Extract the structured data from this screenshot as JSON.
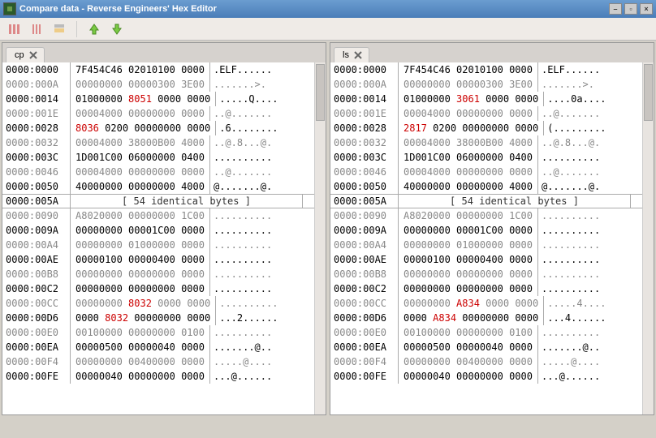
{
  "window_title": "Compare data - Reverse Engineers' Hex Editor",
  "toolbar": {
    "icons": [
      "bars-wide-icon",
      "bars-mid-icon",
      "bars-narrow-icon",
      "arrow-up-icon",
      "arrow-down-icon"
    ]
  },
  "panes": [
    {
      "tab_label": "cp",
      "collapsed": {
        "addr": "0000:005A",
        "msg": "[ 54 identical bytes ]"
      },
      "rows_top": [
        {
          "a": "0000:0000",
          "h": [
            [
              "7F454C46",
              0
            ],
            [
              "02010100",
              0
            ],
            [
              "0000",
              0
            ]
          ],
          "t": ".ELF......"
        },
        {
          "a": "0000:000A",
          "m": 1,
          "h": [
            [
              "00000000",
              0
            ],
            [
              "00000300",
              0
            ],
            [
              "3E00",
              0
            ]
          ],
          "t": ".......>."
        },
        {
          "a": "0000:0014",
          "h": [
            [
              "01000000",
              0
            ],
            [
              "8051",
              1
            ],
            [
              "0000",
              0
            ],
            [
              "0000",
              0
            ]
          ],
          "t": ".....Q...."
        },
        {
          "a": "0000:001E",
          "m": 1,
          "h": [
            [
              "00004000",
              0
            ],
            [
              "00000000",
              0
            ],
            [
              "0000",
              0
            ]
          ],
          "t": "..@......."
        },
        {
          "a": "0000:0028",
          "h": [
            [
              "8036",
              1
            ],
            [
              "0200",
              0
            ],
            [
              "00000000",
              0
            ],
            [
              "0000",
              0
            ]
          ],
          "t": ".6........"
        },
        {
          "a": "0000:0032",
          "m": 1,
          "h": [
            [
              "00004000",
              0
            ],
            [
              "38000B00",
              0
            ],
            [
              "4000",
              0
            ]
          ],
          "t": "..@.8...@."
        },
        {
          "a": "0000:003C",
          "h": [
            [
              "1D001C00",
              0
            ],
            [
              "06000000",
              0
            ],
            [
              "0400",
              0
            ]
          ],
          "t": ".........."
        },
        {
          "a": "0000:0046",
          "m": 1,
          "h": [
            [
              "00004000",
              0
            ],
            [
              "00000000",
              0
            ],
            [
              "0000",
              0
            ]
          ],
          "t": "..@......."
        },
        {
          "a": "0000:0050",
          "h": [
            [
              "40000000",
              0
            ],
            [
              "00000000",
              0
            ],
            [
              "4000",
              0
            ]
          ],
          "t": "@.......@."
        }
      ],
      "rows_bot": [
        {
          "a": "0000:0090",
          "m": 1,
          "h": [
            [
              "A8020000",
              0
            ],
            [
              "00000000",
              0
            ],
            [
              "1C00",
              0
            ]
          ],
          "t": ".........."
        },
        {
          "a": "0000:009A",
          "h": [
            [
              "00000000",
              0
            ],
            [
              "00001C00",
              0
            ],
            [
              "0000",
              0
            ]
          ],
          "t": ".........."
        },
        {
          "a": "0000:00A4",
          "m": 1,
          "h": [
            [
              "00000000",
              0
            ],
            [
              "01000000",
              0
            ],
            [
              "0000",
              0
            ]
          ],
          "t": ".........."
        },
        {
          "a": "0000:00AE",
          "h": [
            [
              "00000100",
              0
            ],
            [
              "00000400",
              0
            ],
            [
              "0000",
              0
            ]
          ],
          "t": ".........."
        },
        {
          "a": "0000:00B8",
          "m": 1,
          "h": [
            [
              "00000000",
              0
            ],
            [
              "00000000",
              0
            ],
            [
              "0000",
              0
            ]
          ],
          "t": ".........."
        },
        {
          "a": "0000:00C2",
          "h": [
            [
              "00000000",
              0
            ],
            [
              "00000000",
              0
            ],
            [
              "0000",
              0
            ]
          ],
          "t": ".........."
        },
        {
          "a": "0000:00CC",
          "m": 1,
          "h": [
            [
              "00000000",
              0
            ],
            [
              "8032",
              1
            ],
            [
              "0000",
              0
            ],
            [
              "0000",
              0
            ]
          ],
          "t": ".........."
        },
        {
          "a": "0000:00D6",
          "h": [
            [
              "0000",
              0
            ],
            [
              "8032",
              1
            ],
            [
              "00000000",
              0
            ],
            [
              "0000",
              0
            ]
          ],
          "t": "...2......"
        },
        {
          "a": "0000:00E0",
          "m": 1,
          "h": [
            [
              "00100000",
              0
            ],
            [
              "00000000",
              0
            ],
            [
              "0100",
              0
            ]
          ],
          "t": ".........."
        },
        {
          "a": "0000:00EA",
          "h": [
            [
              "00000500",
              0
            ],
            [
              "00000040",
              0
            ],
            [
              "0000",
              0
            ]
          ],
          "t": ".......@.."
        },
        {
          "a": "0000:00F4",
          "m": 1,
          "h": [
            [
              "00000000",
              0
            ],
            [
              "00400000",
              0
            ],
            [
              "0000",
              0
            ]
          ],
          "t": ".....@...."
        },
        {
          "a": "0000:00FE",
          "h": [
            [
              "00000040",
              0
            ],
            [
              "00000000",
              0
            ],
            [
              "0000",
              0
            ]
          ],
          "t": "...@......"
        }
      ]
    },
    {
      "tab_label": "ls",
      "collapsed": {
        "addr": "0000:005A",
        "msg": "[ 54 identical bytes ]"
      },
      "rows_top": [
        {
          "a": "0000:0000",
          "h": [
            [
              "7F454C46",
              0
            ],
            [
              "02010100",
              0
            ],
            [
              "0000",
              0
            ]
          ],
          "t": ".ELF......"
        },
        {
          "a": "0000:000A",
          "m": 1,
          "h": [
            [
              "00000000",
              0
            ],
            [
              "00000300",
              0
            ],
            [
              "3E00",
              0
            ]
          ],
          "t": ".......>."
        },
        {
          "a": "0000:0014",
          "h": [
            [
              "01000000",
              0
            ],
            [
              "3061",
              1
            ],
            [
              "0000",
              0
            ],
            [
              "0000",
              0
            ]
          ],
          "t": "....0a...."
        },
        {
          "a": "0000:001E",
          "m": 1,
          "h": [
            [
              "00004000",
              0
            ],
            [
              "00000000",
              0
            ],
            [
              "0000",
              0
            ]
          ],
          "t": "..@......."
        },
        {
          "a": "0000:0028",
          "h": [
            [
              "2817",
              1
            ],
            [
              "0200",
              0
            ],
            [
              "00000000",
              0
            ],
            [
              "0000",
              0
            ]
          ],
          "t": "(........."
        },
        {
          "a": "0000:0032",
          "m": 1,
          "h": [
            [
              "00004000",
              0
            ],
            [
              "38000B00",
              0
            ],
            [
              "4000",
              0
            ]
          ],
          "t": "..@.8...@."
        },
        {
          "a": "0000:003C",
          "h": [
            [
              "1D001C00",
              0
            ],
            [
              "06000000",
              0
            ],
            [
              "0400",
              0
            ]
          ],
          "t": ".........."
        },
        {
          "a": "0000:0046",
          "m": 1,
          "h": [
            [
              "00004000",
              0
            ],
            [
              "00000000",
              0
            ],
            [
              "0000",
              0
            ]
          ],
          "t": "..@......."
        },
        {
          "a": "0000:0050",
          "h": [
            [
              "40000000",
              0
            ],
            [
              "00000000",
              0
            ],
            [
              "4000",
              0
            ]
          ],
          "t": "@.......@."
        }
      ],
      "rows_bot": [
        {
          "a": "0000:0090",
          "m": 1,
          "h": [
            [
              "A8020000",
              0
            ],
            [
              "00000000",
              0
            ],
            [
              "1C00",
              0
            ]
          ],
          "t": ".........."
        },
        {
          "a": "0000:009A",
          "h": [
            [
              "00000000",
              0
            ],
            [
              "00001C00",
              0
            ],
            [
              "0000",
              0
            ]
          ],
          "t": ".........."
        },
        {
          "a": "0000:00A4",
          "m": 1,
          "h": [
            [
              "00000000",
              0
            ],
            [
              "01000000",
              0
            ],
            [
              "0000",
              0
            ]
          ],
          "t": ".........."
        },
        {
          "a": "0000:00AE",
          "h": [
            [
              "00000100",
              0
            ],
            [
              "00000400",
              0
            ],
            [
              "0000",
              0
            ]
          ],
          "t": ".........."
        },
        {
          "a": "0000:00B8",
          "m": 1,
          "h": [
            [
              "00000000",
              0
            ],
            [
              "00000000",
              0
            ],
            [
              "0000",
              0
            ]
          ],
          "t": ".........."
        },
        {
          "a": "0000:00C2",
          "h": [
            [
              "00000000",
              0
            ],
            [
              "00000000",
              0
            ],
            [
              "0000",
              0
            ]
          ],
          "t": ".........."
        },
        {
          "a": "0000:00CC",
          "m": 1,
          "h": [
            [
              "00000000",
              0
            ],
            [
              "A834",
              1
            ],
            [
              "0000",
              0
            ],
            [
              "0000",
              0
            ]
          ],
          "t": ".....4...."
        },
        {
          "a": "0000:00D6",
          "h": [
            [
              "0000",
              0
            ],
            [
              "A834",
              1
            ],
            [
              "00000000",
              0
            ],
            [
              "0000",
              0
            ]
          ],
          "t": "...4......"
        },
        {
          "a": "0000:00E0",
          "m": 1,
          "h": [
            [
              "00100000",
              0
            ],
            [
              "00000000",
              0
            ],
            [
              "0100",
              0
            ]
          ],
          "t": ".........."
        },
        {
          "a": "0000:00EA",
          "h": [
            [
              "00000500",
              0
            ],
            [
              "00000040",
              0
            ],
            [
              "0000",
              0
            ]
          ],
          "t": ".......@.."
        },
        {
          "a": "0000:00F4",
          "m": 1,
          "h": [
            [
              "00000000",
              0
            ],
            [
              "00400000",
              0
            ],
            [
              "0000",
              0
            ]
          ],
          "t": ".....@...."
        },
        {
          "a": "0000:00FE",
          "h": [
            [
              "00000040",
              0
            ],
            [
              "00000000",
              0
            ],
            [
              "0000",
              0
            ]
          ],
          "t": "...@......"
        }
      ]
    }
  ]
}
